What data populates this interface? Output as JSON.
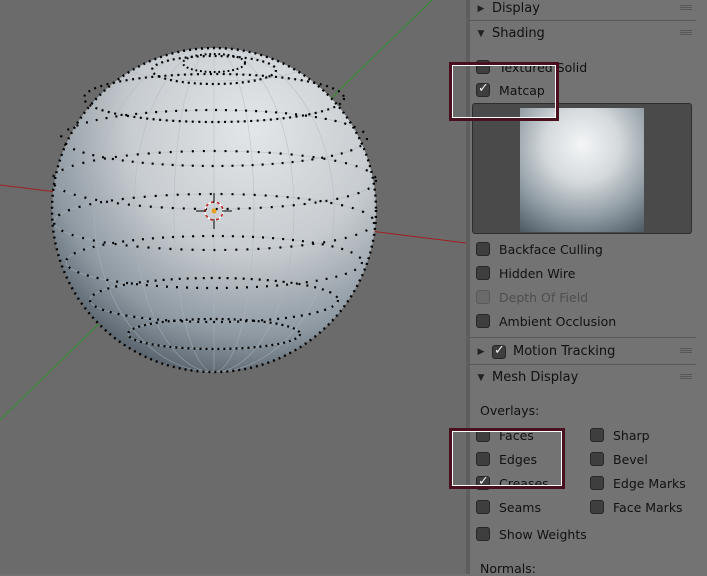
{
  "panel": {
    "display_header": "Display",
    "shading_header": "Shading",
    "textured_solid_label": "Textured Solid",
    "matcap_label": "Matcap",
    "backface_culling_label": "Backface Culling",
    "hidden_wire_label": "Hidden Wire",
    "depth_of_field_label": "Depth Of Field",
    "ambient_occlusion_label": "Ambient Occlusion",
    "motion_tracking_header": "Motion Tracking",
    "mesh_display_header": "Mesh Display",
    "overlays_label": "Overlays:",
    "overlays": {
      "faces": "Faces",
      "edges": "Edges",
      "creases": "Creases",
      "seams": "Seams",
      "show_weights": "Show Weights",
      "sharp": "Sharp",
      "bevel": "Bevel",
      "edge_marks": "Edge Marks",
      "face_marks": "Face Marks"
    },
    "normals_label": "Normals:"
  },
  "colors": {
    "viewport_bg": "#6b6b6b",
    "panel_bg": "#737373",
    "highlight_border": "#4a0f1f",
    "x_axis": "#a02020",
    "y_axis": "#2f8f2f"
  },
  "icons": [
    "expand-triangle-icon",
    "collapse-triangle-icon",
    "checkbox-icon",
    "drag-grip-icon",
    "3d-cursor-icon"
  ]
}
